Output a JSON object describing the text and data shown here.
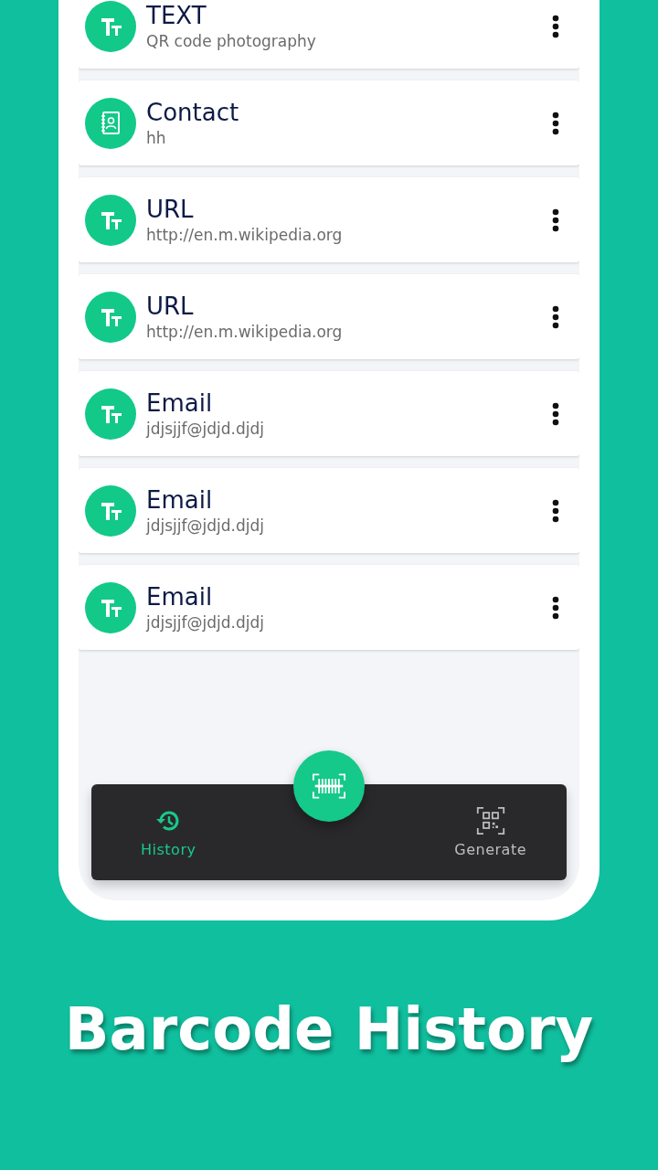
{
  "history": [
    {
      "kind": "text",
      "title": "TEXT",
      "subtitle": "QR code photography"
    },
    {
      "kind": "contact",
      "title": "Contact",
      "subtitle": "hh"
    },
    {
      "kind": "text",
      "title": "URL",
      "subtitle": "http://en.m.wikipedia.org"
    },
    {
      "kind": "text",
      "title": "URL",
      "subtitle": "http://en.m.wikipedia.org"
    },
    {
      "kind": "text",
      "title": "Email",
      "subtitle": "jdjsjjf@jdjd.djdj"
    },
    {
      "kind": "text",
      "title": "Email",
      "subtitle": "jdjsjjf@jdjd.djdj"
    },
    {
      "kind": "text",
      "title": "Email",
      "subtitle": "jdjsjjf@jdjd.djdj"
    }
  ],
  "bottom_nav": [
    {
      "kind": "history",
      "label": "History",
      "selected": true
    },
    {
      "kind": "generate",
      "label": "Generate",
      "selected": false
    }
  ],
  "headline": "Barcode History"
}
